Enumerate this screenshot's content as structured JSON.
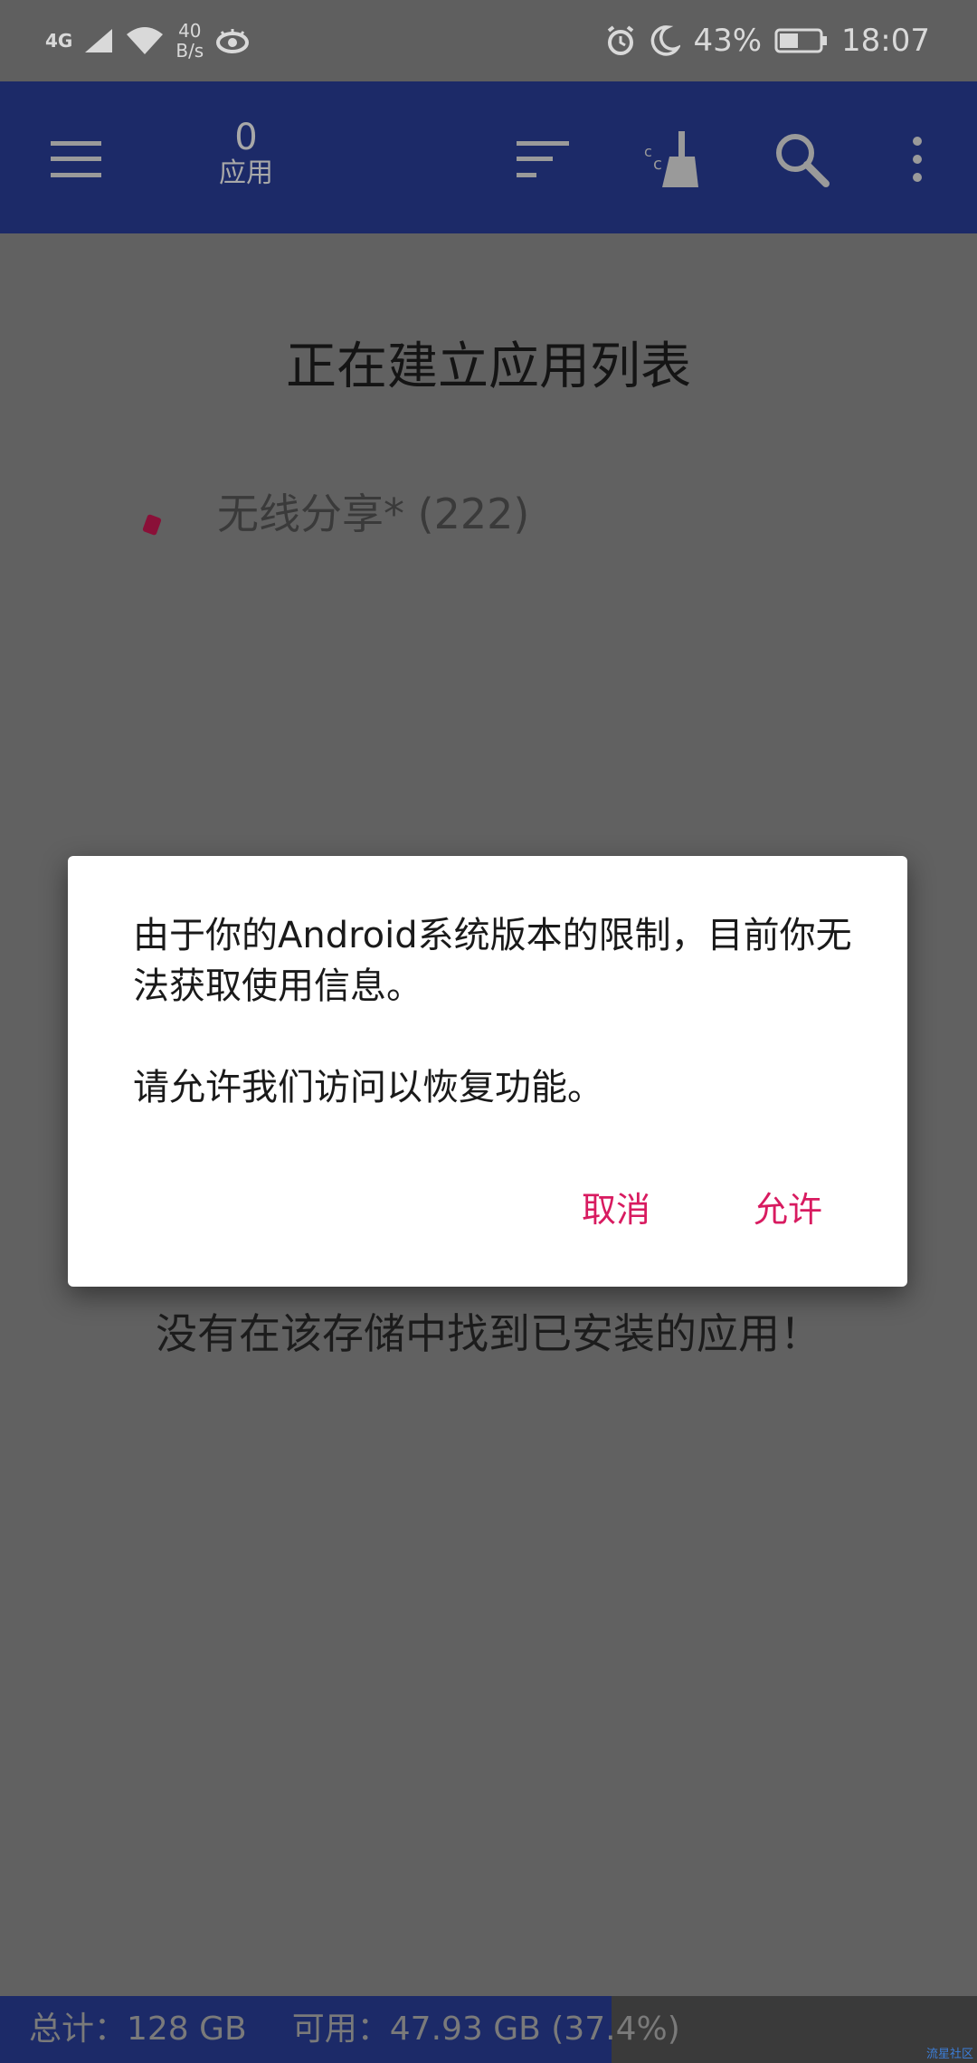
{
  "status_bar": {
    "network": "4G",
    "speed_value": "40",
    "speed_unit": "B/s",
    "battery": "43%",
    "time": "18:07",
    "icons": [
      "signal-icon",
      "wifi-icon",
      "eye-icon",
      "alarm-icon",
      "moon-icon",
      "battery-icon"
    ]
  },
  "app_bar": {
    "count": "0",
    "count_label": "应用",
    "background": "#1c2a68",
    "icons": [
      "menu-icon",
      "sort-icon",
      "cleaner-icon",
      "search-icon",
      "more-vert-icon"
    ]
  },
  "main": {
    "building_title": "正在建立应用列表",
    "progress_text": "无线分享* (222)",
    "empty_message": "没有在该存储中找到已安装的应用！"
  },
  "dialog": {
    "message_line1": "由于你的Android系统版本的限制，目前你无法获取使用信息。",
    "message_line2": "请允许我们访问以恢复功能。",
    "cancel_label": "取消",
    "allow_label": "允许",
    "accent": "#d81b60"
  },
  "footer": {
    "total": "总计：128 GB",
    "available": "可用：47.93 GB (37.4%)",
    "used_fraction": 0.626
  },
  "watermark": "流星社区"
}
